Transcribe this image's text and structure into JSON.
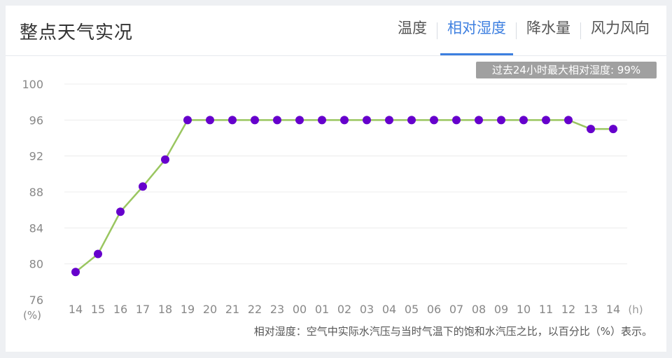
{
  "header": {
    "title": "整点天气实况",
    "tabs": [
      {
        "label": "温度",
        "active": false
      },
      {
        "label": "相对湿度",
        "active": true
      },
      {
        "label": "降水量",
        "active": false
      },
      {
        "label": "风力风向",
        "active": false
      }
    ]
  },
  "badge": "过去24小时最大相对湿度: 99%",
  "note": "相对湿度：空气中实际水汽压与当时气温下的饱和水汽压之比，以百分比（%）表示。",
  "colors": {
    "line": "#9ac660",
    "point": "#6600cc",
    "accent": "#3d7fe0"
  },
  "chart_data": {
    "type": "line",
    "x": [
      "14",
      "15",
      "16",
      "17",
      "18",
      "19",
      "20",
      "21",
      "22",
      "23",
      "00",
      "01",
      "02",
      "03",
      "04",
      "05",
      "06",
      "07",
      "08",
      "09",
      "10",
      "11",
      "12",
      "13",
      "14"
    ],
    "values": [
      79.1,
      81.1,
      85.8,
      88.6,
      91.6,
      96.0,
      96.0,
      96.0,
      96.0,
      96.0,
      96.0,
      96.0,
      96.0,
      96.0,
      96.0,
      96.0,
      96.0,
      96.0,
      96.0,
      96.0,
      96.0,
      96.0,
      96.0,
      95.0,
      95.0
    ],
    "yticks": [
      "100",
      "96",
      "92",
      "88",
      "84",
      "80",
      "76"
    ],
    "ylim": [
      76,
      100
    ],
    "xunit": "(h)",
    "yunit": "(%)",
    "grid": true
  }
}
